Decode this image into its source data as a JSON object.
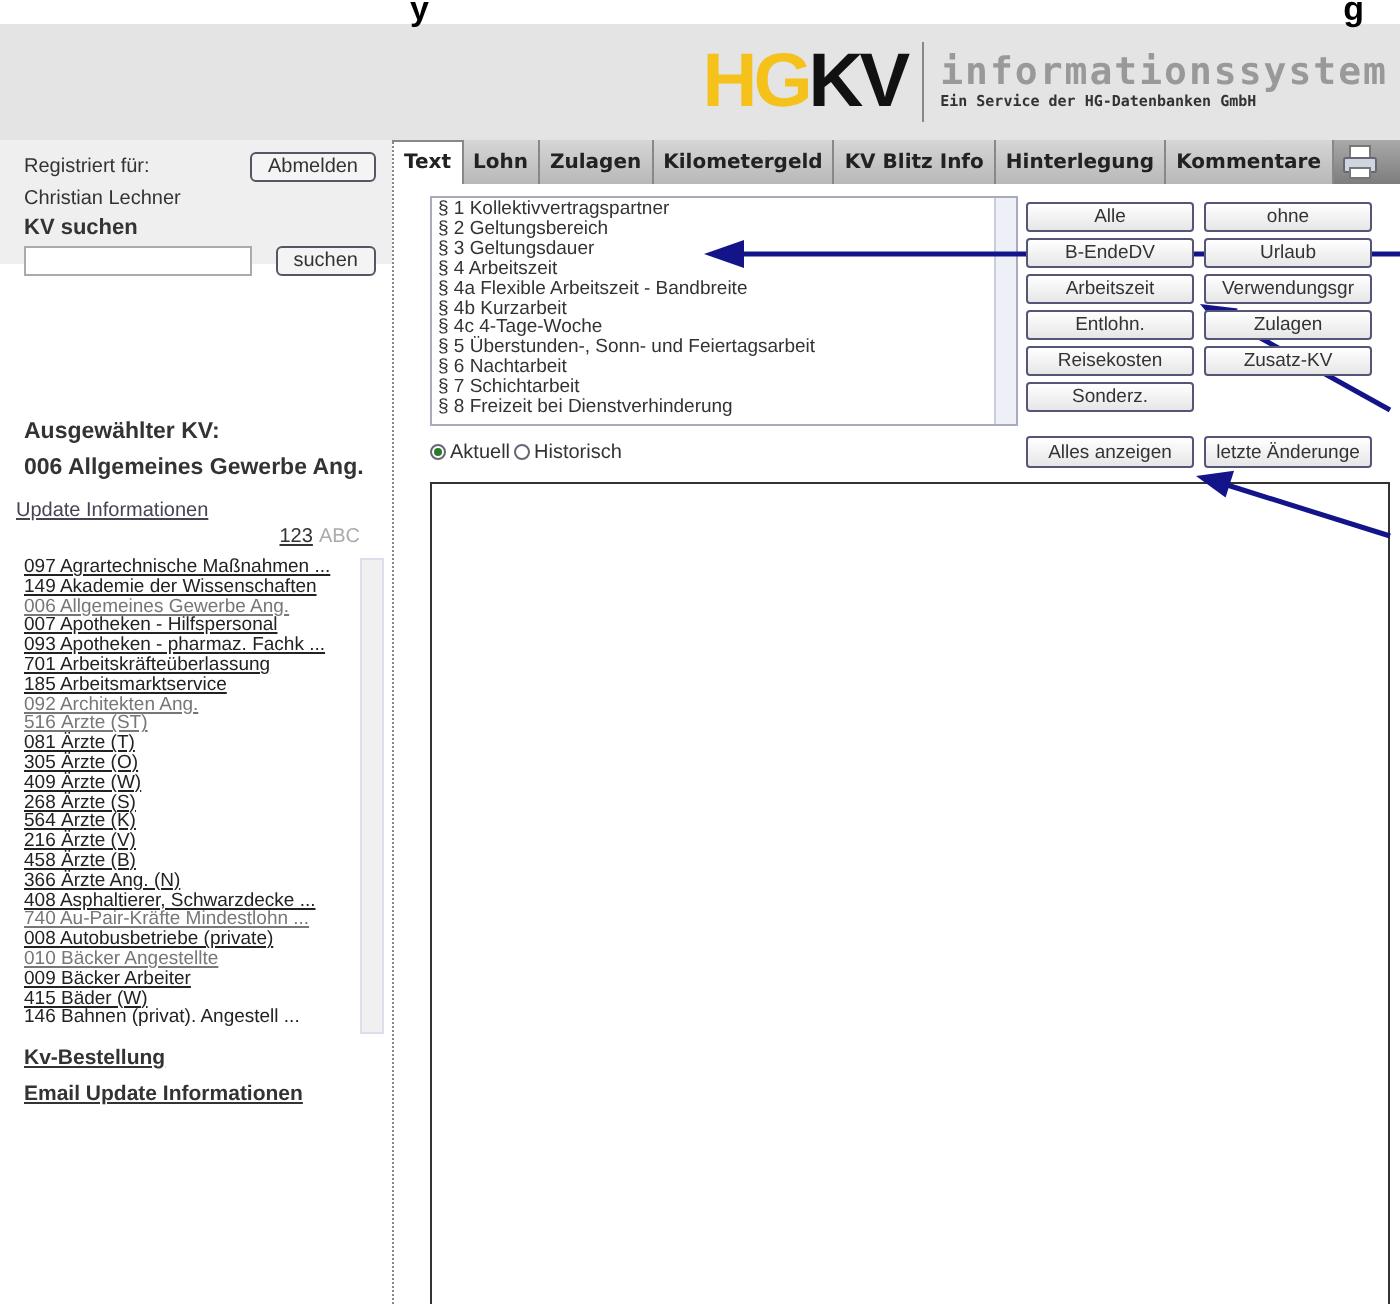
{
  "title_fragments": [
    "y",
    "g"
  ],
  "header": {
    "logo_part_1": "HG",
    "logo_part_2": "KV",
    "product": "informationssystem",
    "tagline": "Ein Service der HG-Datenbanken GmbH"
  },
  "sidebar": {
    "registered_label": "Registriert für:",
    "logout_button": "Abmelden",
    "user_name": "Christian Lechner",
    "search_heading": "KV suchen",
    "search_button": "suchen",
    "selected_heading": "Ausgewählter KV:",
    "selected_kv": "006 Allgemeines Gewerbe Ang.",
    "update_link": "Update Informationen",
    "sort_options": [
      {
        "label": "123",
        "selected": false
      },
      {
        "label": "ABC",
        "selected": true
      }
    ],
    "kv_list": [
      {
        "label": "097 Agrartechnische Maßnahmen ...",
        "dim": false
      },
      {
        "label": "149 Akademie der Wissenschaften",
        "dim": false
      },
      {
        "label": "006 Allgemeines Gewerbe Ang.",
        "dim": true
      },
      {
        "label": "007 Apotheken - Hilfspersonal",
        "dim": false
      },
      {
        "label": "093 Apotheken - pharmaz. Fachk ...",
        "dim": false
      },
      {
        "label": "701 Arbeitskräfteüberlassung",
        "dim": false
      },
      {
        "label": "185 Arbeitsmarktservice",
        "dim": false
      },
      {
        "label": "092 Architekten Ang.",
        "dim": true
      },
      {
        "label": "516 Ärzte (ST)",
        "dim": true
      },
      {
        "label": "081 Ärzte (T)",
        "dim": false
      },
      {
        "label": "305 Ärzte (O)",
        "dim": false
      },
      {
        "label": "409 Ärzte (W)",
        "dim": false
      },
      {
        "label": "268 Ärzte (S)",
        "dim": false
      },
      {
        "label": "564 Ärzte (K)",
        "dim": false
      },
      {
        "label": "216 Ärzte (V)",
        "dim": false
      },
      {
        "label": "458 Ärzte (B)",
        "dim": false
      },
      {
        "label": "366 Ärzte Ang. (N)",
        "dim": false
      },
      {
        "label": "408 Asphaltierer, Schwarzdecke ...",
        "dim": false
      },
      {
        "label": "740 Au-Pair-Kräfte Mindestlohn ...",
        "dim": true
      },
      {
        "label": "008 Autobusbetriebe (private)",
        "dim": false
      },
      {
        "label": "010 Bäcker Angestellte",
        "dim": true
      },
      {
        "label": "009 Bäcker Arbeiter",
        "dim": false
      },
      {
        "label": "415 Bäder (W)",
        "dim": false
      },
      {
        "label": "146 Bahnen (privat). Angestell ...",
        "dim": false
      }
    ],
    "order_link": "Kv-Bestellung",
    "email_link": "Email Update Informationen"
  },
  "tabs": [
    {
      "label": "Text",
      "selected": true
    },
    {
      "label": "Lohn",
      "selected": false
    },
    {
      "label": "Zulagen",
      "selected": false
    },
    {
      "label": "Kilometergeld",
      "selected": false
    },
    {
      "label": "KV Blitz Info",
      "selected": false
    },
    {
      "label": "Hinterlegung",
      "selected": false
    },
    {
      "label": "Kommentare",
      "selected": false
    }
  ],
  "paragraphs": [
    "§ 1 Kollektivvertragspartner",
    "§ 2 Geltungsbereich",
    "§ 3 Geltungsdauer",
    "§ 4 Arbeitszeit",
    "§ 4a Flexible Arbeitszeit - Bandbreite",
    "§ 4b Kurzarbeit",
    "§ 4c 4-Tage-Woche",
    "§ 5 Überstunden-, Sonn- und Feiertagsarbeit",
    "§ 6 Nachtarbeit",
    "§ 7 Schichtarbeit",
    "§ 8 Freizeit bei Dienstverhinderung"
  ],
  "filter_buttons": [
    "Alle",
    "ohne",
    "B-EndeDV",
    "Urlaub",
    "Arbeitszeit",
    "Verwendungsgr",
    "Entlohn.",
    "Zulagen",
    "Reisekosten",
    "Zusatz-KV",
    "Sonderz."
  ],
  "version_options": [
    {
      "label": "Aktuell",
      "selected": true
    },
    {
      "label": "Historisch",
      "selected": false
    }
  ],
  "action_buttons": [
    "Alles anzeigen",
    "letzte Änderunge"
  ]
}
